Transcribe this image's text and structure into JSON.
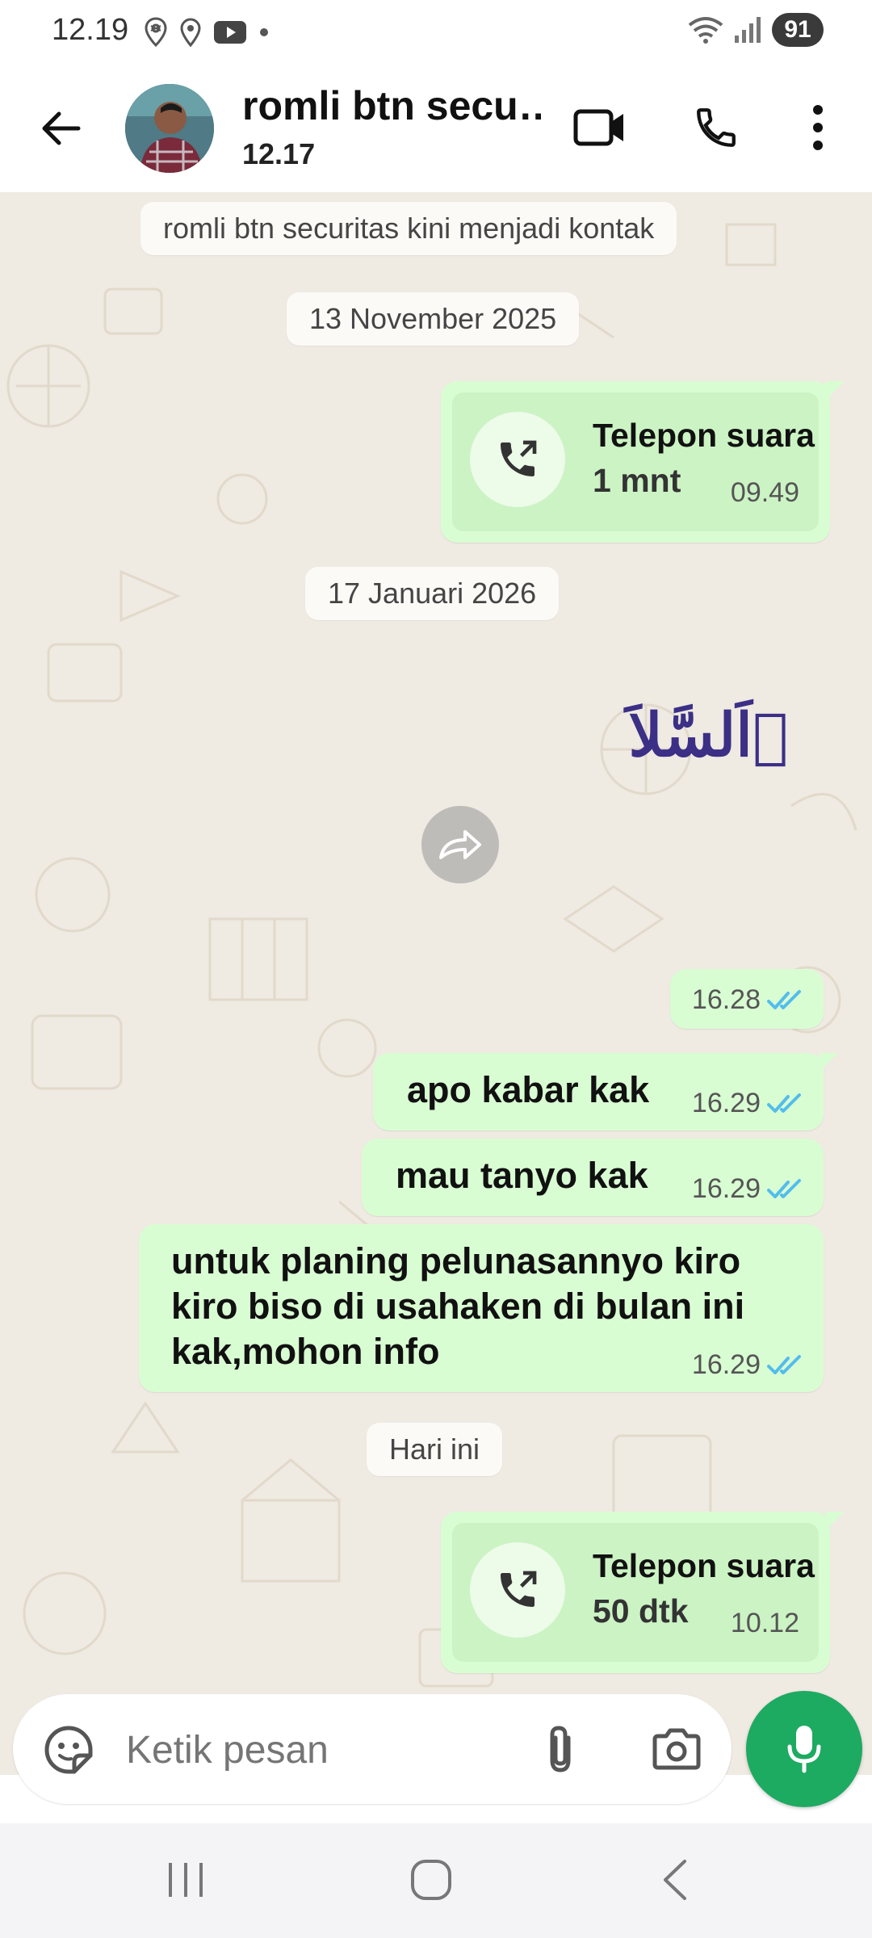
{
  "status_bar": {
    "time": "12.19",
    "battery": "91",
    "icons": [
      "location-pin-icon",
      "location-icon",
      "youtube-icon",
      "dot-icon",
      "wifi-icon",
      "signal-icon",
      "battery-icon"
    ]
  },
  "header": {
    "contact_name": "romli btn secu…",
    "last_seen": "12.17",
    "icons": [
      "back-arrow-icon",
      "video-call-icon",
      "phone-icon",
      "more-vert-icon"
    ]
  },
  "chat": {
    "system_contact_notice": "romli btn securitas kini menjadi kontak",
    "date_1": "13 November 2025",
    "call_1": {
      "title": "Telepon suara",
      "duration": "1 mnt",
      "time": "09.49"
    },
    "date_2": "17 Januari 2026",
    "arabic_text": "اَلسَّلاَ ُ",
    "arabic_meta_time": "16.28",
    "messages": [
      {
        "text": "apo kabar kak",
        "time": "16.29"
      },
      {
        "text": "mau tanyo kak",
        "time": "16.29"
      },
      {
        "text": "untuk planing pelunasannyo kiro kiro biso di usahaken di bulan ini kak,mohon info",
        "time": "16.29"
      }
    ],
    "date_3": "Hari ini",
    "call_2": {
      "title": "Telepon suara",
      "duration": "50 dtk",
      "time": "10.12"
    }
  },
  "input": {
    "placeholder": "Ketik pesan"
  },
  "colors": {
    "outgoing_bubble": "#d9fdd3",
    "chat_background": "#efeae2",
    "read_ticks": "#53bdeb",
    "accent_green": "#1daa61"
  }
}
